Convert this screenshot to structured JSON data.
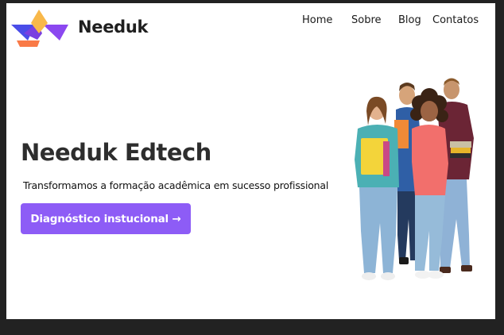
{
  "header": {
    "brand_name": "Needuk",
    "logo_icon": "needuk-logo-icon",
    "nav": {
      "home": "Home",
      "sobre": "Sobre",
      "blog": "Blog",
      "contatos": "Contatos"
    }
  },
  "hero": {
    "title": "Needuk Edtech",
    "subtitle": "Transformamos a formação acadêmica em sucesso profissional",
    "cta_label": "Diagnóstico instucional →",
    "image_icon": "students-group-image"
  },
  "colors": {
    "accent": "#8d5cf6",
    "logo_orange": "#f97a47",
    "logo_blue": "#4a4de8",
    "logo_yellow": "#f8b84a",
    "window_frame": "#222222"
  }
}
